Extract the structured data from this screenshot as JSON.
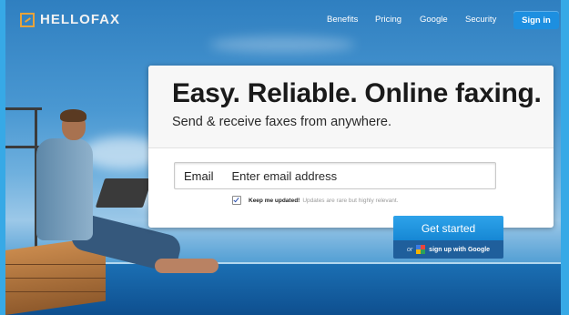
{
  "nav": {
    "logo_text": "HELLOFAX",
    "links": [
      "Benefits",
      "Pricing",
      "Google",
      "Security"
    ],
    "signin_label": "Sign in"
  },
  "hero": {
    "headline": "Easy. Reliable. Online faxing.",
    "subheadline": "Send & receive faxes from anywhere."
  },
  "form": {
    "email_label": "Email",
    "email_placeholder": "Enter email address",
    "keep_updated_label": "Keep me updated!",
    "keep_updated_note": "Updates are rare but highly relevant.",
    "keep_updated_checked": true,
    "submit_label": "Get started",
    "google_or": "or",
    "google_label": "sign up with Google"
  },
  "colors": {
    "accent": "#1d8fe0",
    "logo": "#e8a33a",
    "google_bar": "#1f5f9c"
  },
  "icons": [
    "logo-fax-icon",
    "google-icon",
    "checkbox-check-icon"
  ]
}
